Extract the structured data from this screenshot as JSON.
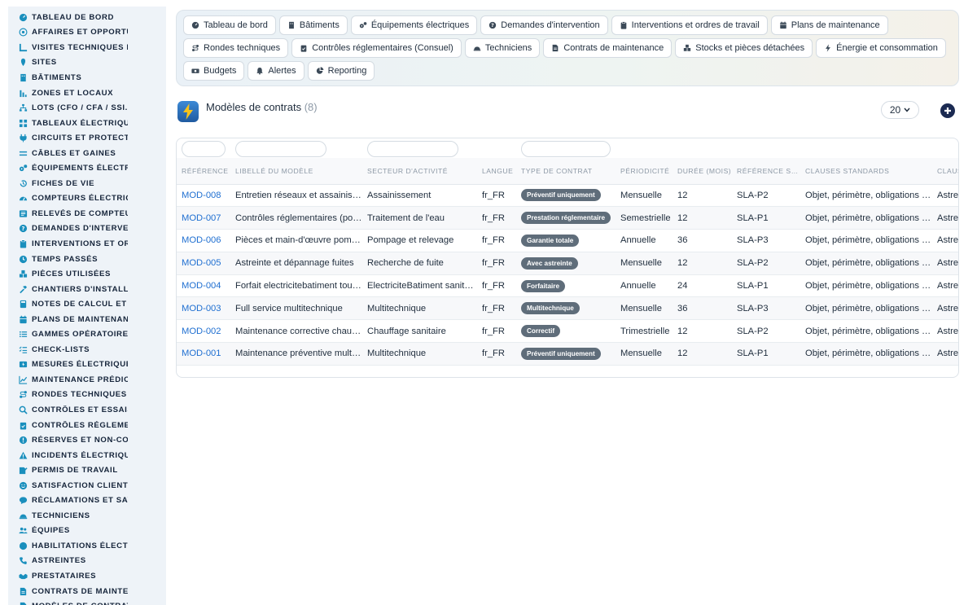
{
  "sidebar": {
    "items": [
      {
        "label": "TABLEAU DE BORD",
        "icon": "dashboard-icon"
      },
      {
        "label": "AFFAIRES ET OPPORTUNITÉS",
        "icon": "target-icon"
      },
      {
        "label": "VISITES TECHNIQUES ET RELEVÉS",
        "icon": "ruler-icon"
      },
      {
        "label": "SITES",
        "icon": "location-icon"
      },
      {
        "label": "BÂTIMENTS",
        "icon": "building-icon"
      },
      {
        "label": "ZONES ET LOCAUX",
        "icon": "zones-icon"
      },
      {
        "label": "LOTS (CFO / CFA / SSI...)",
        "icon": "sitemap-icon"
      },
      {
        "label": "TABLEAUX ÉLECTRIQUES",
        "icon": "grid-icon"
      },
      {
        "label": "CIRCUITS ET PROTECTIONS",
        "icon": "plug-icon"
      },
      {
        "label": "CÂBLES ET GAINES",
        "icon": "lines-icon"
      },
      {
        "label": "ÉQUIPEMENTS ÉLECTRIQUES",
        "icon": "gears-icon"
      },
      {
        "label": "FICHES DE VIE",
        "icon": "history-icon"
      },
      {
        "label": "COMPTEURS ÉLECTRIQUES",
        "icon": "gauge-icon"
      },
      {
        "label": "RELEVÉS DE COMPTEURS",
        "icon": "list-check-icon"
      },
      {
        "label": "DEMANDES D'INTERVENTION",
        "icon": "question-icon"
      },
      {
        "label": "INTERVENTIONS ET ORDRES DE TRAVAIL",
        "icon": "clipboard-icon"
      },
      {
        "label": "TEMPS PASSÉS",
        "icon": "clock-icon"
      },
      {
        "label": "PIÈCES UTILISÉES",
        "icon": "boxes-icon"
      },
      {
        "label": "CHANTIERS D'INSTALLATION",
        "icon": "hammer-icon"
      },
      {
        "label": "NOTES DE CALCUL ET ÉTUDES",
        "icon": "calculator-icon"
      },
      {
        "label": "PLANS DE MAINTENANCE",
        "icon": "calendar-icon"
      },
      {
        "label": "GAMMES OPÉRATOIRES",
        "icon": "list-icon"
      },
      {
        "label": "CHECK-LISTS",
        "icon": "checklist-icon"
      },
      {
        "label": "MESURES ÉLECTRIQUES",
        "icon": "bolt-gauge-icon"
      },
      {
        "label": "MAINTENANCE PRÉDICTIVE",
        "icon": "chart-icon"
      },
      {
        "label": "RONDES TECHNIQUES",
        "icon": "route-icon"
      },
      {
        "label": "CONTRÔLES ET ESSAIS",
        "icon": "search-icon"
      },
      {
        "label": "CONTRÔLES RÉGLEMENTAIRES",
        "icon": "clipboard-check-icon"
      },
      {
        "label": "RÉSERVES ET NON-CONFORMITÉS",
        "icon": "exclamation-icon"
      },
      {
        "label": "INCIDENTS ÉLECTRIQUES",
        "icon": "warning-icon"
      },
      {
        "label": "PERMIS DE TRAVAIL",
        "icon": "signature-icon"
      },
      {
        "label": "SATISFACTION CLIENT",
        "icon": "smile-icon"
      },
      {
        "label": "RÉCLAMATIONS ET SAV",
        "icon": "comment-icon"
      },
      {
        "label": "TECHNICIENS",
        "icon": "helmet-icon"
      },
      {
        "label": "ÉQUIPES",
        "icon": "users-icon"
      },
      {
        "label": "HABILITATIONS ÉLECTRIQUES",
        "icon": "certificate-icon"
      },
      {
        "label": "ASTREINTES",
        "icon": "phone-icon"
      },
      {
        "label": "PRESTATAIRES",
        "icon": "handshake-icon"
      },
      {
        "label": "CONTRATS DE MAINTENANCE",
        "icon": "contract-icon"
      },
      {
        "label": "MODÈLES DE CONTRATS",
        "icon": "file-icon"
      }
    ]
  },
  "topnav": {
    "buttons": [
      {
        "label": "Tableau de bord",
        "icon": "dashboard-icon"
      },
      {
        "label": "Bâtiments",
        "icon": "building-icon"
      },
      {
        "label": "Équipements électriques",
        "icon": "gears-icon"
      },
      {
        "label": "Demandes d'intervention",
        "icon": "question-icon"
      },
      {
        "label": "Interventions et ordres de travail",
        "icon": "clipboard-icon"
      },
      {
        "label": "Plans de maintenance",
        "icon": "calendar-icon"
      },
      {
        "label": "Rondes techniques",
        "icon": "route-icon"
      },
      {
        "label": "Contrôles réglementaires (Consuel)",
        "icon": "clipboard-check-icon"
      },
      {
        "label": "Techniciens",
        "icon": "helmet-icon"
      },
      {
        "label": "Contrats de maintenance",
        "icon": "contract-icon"
      },
      {
        "label": "Stocks et pièces détachées",
        "icon": "boxes-icon"
      },
      {
        "label": "Énergie et consommation",
        "icon": "bolt-icon"
      },
      {
        "label": "Budgets",
        "icon": "money-icon"
      },
      {
        "label": "Alertes",
        "icon": "bell-icon"
      },
      {
        "label": "Reporting",
        "icon": "pie-icon"
      }
    ]
  },
  "header": {
    "title": "Modèles de contrats",
    "count": "(8)",
    "per_page": "20"
  },
  "colors": {
    "sidebar_bg": "#eef3f8",
    "icon_blue": "#1a8fbd",
    "link_blue": "#1f6fd1",
    "badge_bg": "#5f6d7a",
    "add_button": "#1b2a52"
  },
  "table": {
    "columns": [
      "RÉFÉRENCE",
      "LIBELLÉ DU MODÈLE",
      "SECTEUR D'ACTIVITÉ",
      "LANGUE",
      "TYPE DE CONTRAT",
      "PÉRIODICITÉ",
      "DURÉE (MOIS)",
      "RÉFÉRENCE SLA",
      "CLAUSES STANDARDS",
      "CLAUSES"
    ],
    "rows": [
      {
        "ref": "MOD-008",
        "libelle": "Entretien réseaux et assainissement",
        "secteur": "Assainissement",
        "langue": "fr_FR",
        "type": "Préventif uniquement",
        "periodicite": "Mensuelle",
        "duree": "12",
        "sla": "SLA-P2",
        "clauses": "Objet, périmètre, obligations des parties",
        "clauses2": "Astreinte"
      },
      {
        "ref": "MOD-007",
        "libelle": "Contrôles réglementaires (potabilité)",
        "secteur": "Traitement de l'eau",
        "langue": "fr_FR",
        "type": "Prestation réglementaire",
        "periodicite": "Semestrielle",
        "duree": "12",
        "sla": "SLA-P1",
        "clauses": "Objet, périmètre, obligations des parties",
        "clauses2": "Astreinte"
      },
      {
        "ref": "MOD-006",
        "libelle": "Pièces et main-d'œuvre pompage",
        "secteur": "Pompage et relevage",
        "langue": "fr_FR",
        "type": "Garantie totale",
        "periodicite": "Annuelle",
        "duree": "36",
        "sla": "SLA-P3",
        "clauses": "Objet, périmètre, obligations des parties",
        "clauses2": "Astreinte"
      },
      {
        "ref": "MOD-005",
        "libelle": "Astreinte et dépannage fuites",
        "secteur": "Recherche de fuite",
        "langue": "fr_FR",
        "type": "Avec astreinte",
        "periodicite": "Mensuelle",
        "duree": "12",
        "sla": "SLA-P2",
        "clauses": "Objet, périmètre, obligations des parties",
        "clauses2": "Astreinte"
      },
      {
        "ref": "MOD-004",
        "libelle": "Forfait electricitebatiment toutes",
        "secteur": "ElectriciteBatiment sanitaire",
        "langue": "fr_FR",
        "type": "Forfaitaire",
        "periodicite": "Annuelle",
        "duree": "24",
        "sla": "SLA-P1",
        "clauses": "Objet, périmètre, obligations des parties",
        "clauses2": "Astreinte"
      },
      {
        "ref": "MOD-003",
        "libelle": "Full service multitechnique",
        "secteur": "Multitechnique",
        "langue": "fr_FR",
        "type": "Multitechnique",
        "periodicite": "Mensuelle",
        "duree": "36",
        "sla": "SLA-P3",
        "clauses": "Objet, périmètre, obligations des parties",
        "clauses2": "Astreinte"
      },
      {
        "ref": "MOD-002",
        "libelle": "Maintenance corrective chauffage",
        "secteur": "Chauffage sanitaire",
        "langue": "fr_FR",
        "type": "Correctif",
        "periodicite": "Trimestrielle",
        "duree": "12",
        "sla": "SLA-P2",
        "clauses": "Objet, périmètre, obligations des parties",
        "clauses2": "Astreinte"
      },
      {
        "ref": "MOD-001",
        "libelle": "Maintenance préventive multitechnique",
        "secteur": "Multitechnique",
        "langue": "fr_FR",
        "type": "Préventif uniquement",
        "periodicite": "Mensuelle",
        "duree": "12",
        "sla": "SLA-P1",
        "clauses": "Objet, périmètre, obligations des parties",
        "clauses2": "Astreinte"
      }
    ]
  }
}
